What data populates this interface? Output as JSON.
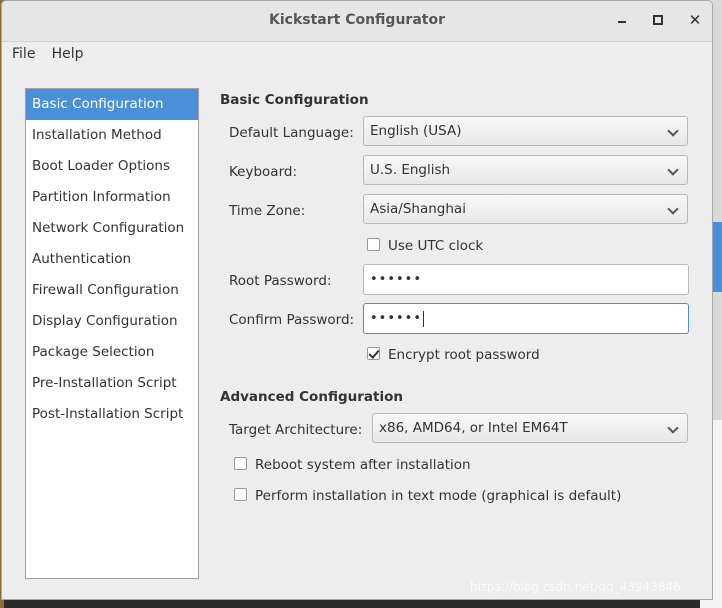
{
  "window": {
    "title": "Kickstart Configurator"
  },
  "menubar": {
    "file": "File",
    "help": "Help"
  },
  "sidebar": {
    "items": [
      {
        "label": "Basic Configuration",
        "selected": true
      },
      {
        "label": "Installation Method"
      },
      {
        "label": "Boot Loader Options"
      },
      {
        "label": "Partition Information"
      },
      {
        "label": "Network Configuration"
      },
      {
        "label": "Authentication"
      },
      {
        "label": "Firewall Configuration"
      },
      {
        "label": "Display Configuration"
      },
      {
        "label": "Package Selection"
      },
      {
        "label": "Pre-Installation Script"
      },
      {
        "label": "Post-Installation Script"
      }
    ]
  },
  "basic": {
    "title": "Basic Configuration",
    "language_label": "Default Language:",
    "language_value": "English (USA)",
    "keyboard_label": "Keyboard:",
    "keyboard_value": "U.S. English",
    "timezone_label": "Time Zone:",
    "timezone_value": "Asia/Shanghai",
    "utc_label": "Use UTC clock",
    "utc_checked": false,
    "root_password_label": "Root Password:",
    "root_password_value": "••••••",
    "confirm_password_label": "Confirm Password:",
    "confirm_password_value": "••••••",
    "encrypt_label": "Encrypt root password",
    "encrypt_checked": true
  },
  "advanced": {
    "title": "Advanced Configuration",
    "arch_label": "Target Architecture:",
    "arch_value": "x86, AMD64, or Intel EM64T",
    "reboot_label": "Reboot system after installation",
    "reboot_checked": false,
    "textmode_label": "Perform installation in text mode (graphical is default)",
    "textmode_checked": false
  },
  "watermark": "https://blog.csdn.net/qq_43943846",
  "colors": {
    "selection": "#4a90d9",
    "window_bg": "#ededed"
  }
}
